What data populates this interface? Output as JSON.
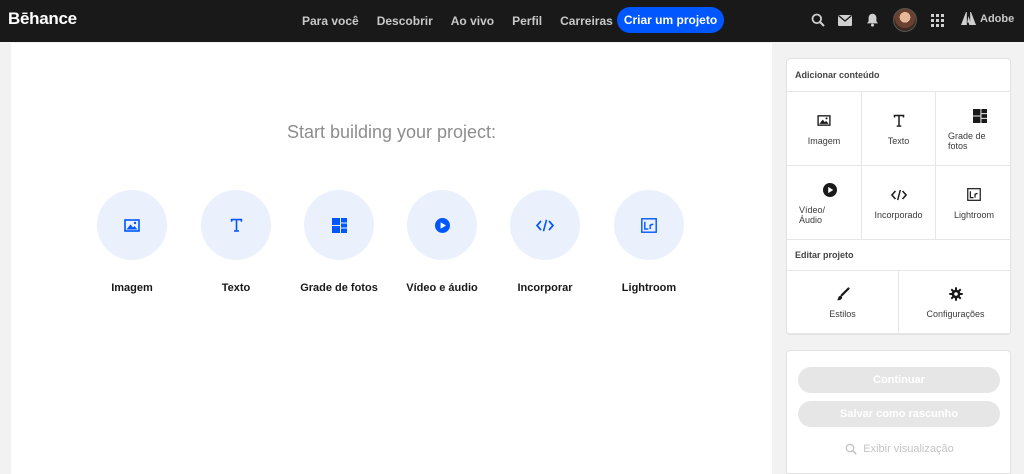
{
  "brand": {
    "logo": "Bēhance"
  },
  "nav": {
    "links": [
      "Para você",
      "Descobrir",
      "Ao vivo",
      "Perfil",
      "Carreiras"
    ],
    "create_button": "Criar um projeto",
    "adobe_label": "Adobe",
    "accent": "#0057ff"
  },
  "icons": [
    "search-icon",
    "mail-icon",
    "bell-icon",
    "avatar",
    "apps-grid-icon",
    "adobe-logo-icon"
  ],
  "editor": {
    "heading": "Start building your project:",
    "tools": [
      "Imagem",
      "Texto",
      "Grade de fotos",
      "Vídeo e áudio",
      "Incorporar",
      "Lightroom"
    ]
  },
  "sidebar": {
    "add_title": "Adicionar conteúdo",
    "add_items": [
      "Imagem",
      "Texto",
      "Grade de fotos",
      "Vídeo/\nÁudio",
      "Incorporado",
      "Lightroom"
    ],
    "edit_title": "Editar projeto",
    "edit_items": [
      "Estilos",
      "Configurações"
    ],
    "continue_button": "Continuar",
    "save_draft_button": "Salvar como rascunho",
    "preview_link": "Exibir visualização"
  }
}
